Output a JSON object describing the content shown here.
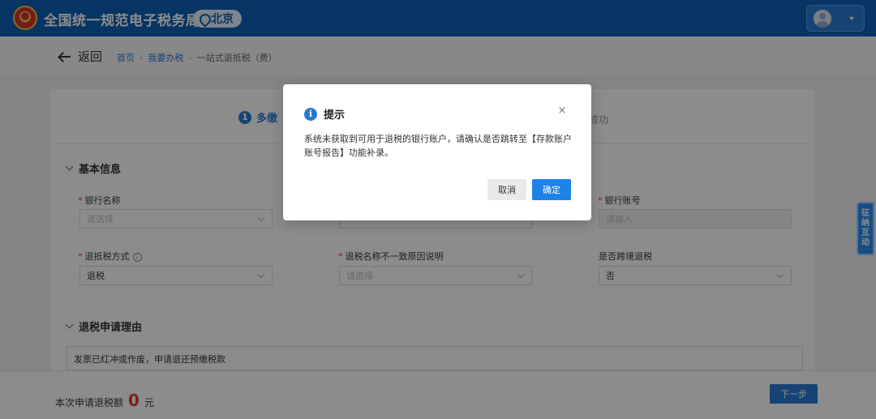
{
  "header": {
    "site_title": "全国统一规范电子税务局",
    "region": "北京",
    "colors": {
      "bar": "#0b5fb4",
      "accent": "#2a79d4"
    }
  },
  "breadcrumb": {
    "back_label": "返回",
    "items": [
      "首页",
      "我要办税",
      "一站式退抵税（费）"
    ]
  },
  "steps": {
    "current_index": "1",
    "current_label": "多缴",
    "last_label": "成功"
  },
  "basic_info": {
    "title": "基本信息",
    "bank_name": {
      "label": "银行名称",
      "placeholder": "请选择"
    },
    "bank_account": {
      "label": "银行账号",
      "placeholder": "请输入"
    },
    "refund_method": {
      "label": "退抵税方式",
      "value": "退税"
    },
    "name_mismatch": {
      "label": "退税名称不一致原因说明",
      "placeholder": "请选择"
    },
    "cross_border": {
      "label": "是否跨境退税",
      "value": "否"
    }
  },
  "reason": {
    "title": "退税申请理由",
    "text": "发票已红冲或作废，申请退还预缴税款"
  },
  "footer": {
    "refund_label": "本次申请退税额",
    "amount": "0",
    "unit": "元",
    "next_label": "下一步"
  },
  "side_tab": {
    "chars": [
      "征",
      "纳",
      "互",
      "动"
    ]
  },
  "dialog": {
    "title": "提示",
    "body": "系统未获取到可用于退税的银行账户，请确认是否跳转至【存款账户账号报告】功能补录。",
    "cancel_label": "取消",
    "ok_label": "确定",
    "close_glyph": "×"
  }
}
